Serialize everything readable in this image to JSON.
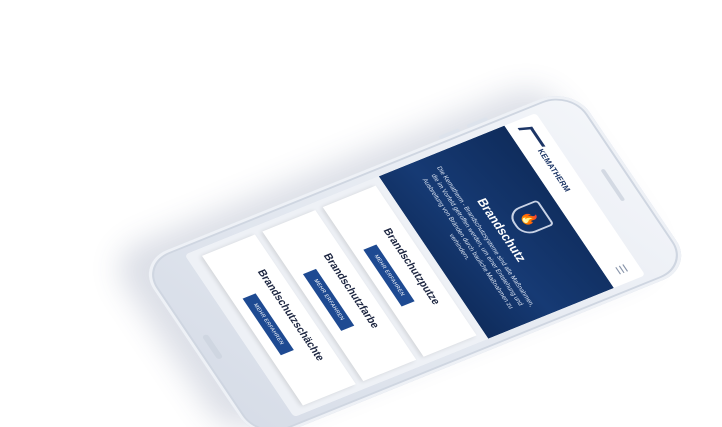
{
  "logo": {
    "text": "KEMATHERM"
  },
  "header": {
    "menu_icon": "hamburger-icon"
  },
  "hero": {
    "icon": "flame-shield-icon",
    "title": "Brandschutz",
    "text": "Die Kematherm - Brandschutzsysteme sind alle Maßnahmen, die im Vorfeld getroffen werden, um einer Entstehung und Ausbreitung von Bränden durch bauliche Maßnahmen zu verhindern."
  },
  "cards": [
    {
      "title": "Brandschutzputze",
      "button": "MEHR ERFAHREN"
    },
    {
      "title": "Brandschutzfarbe",
      "button": "MEHR ERFAHREN"
    },
    {
      "title": "Brandschutzschächte",
      "button": "MEHR ERFAHREN"
    }
  ],
  "colors": {
    "hero_bg": "#0f2c5c",
    "button": "#1e4a92",
    "phone": "#e3e8f0"
  }
}
